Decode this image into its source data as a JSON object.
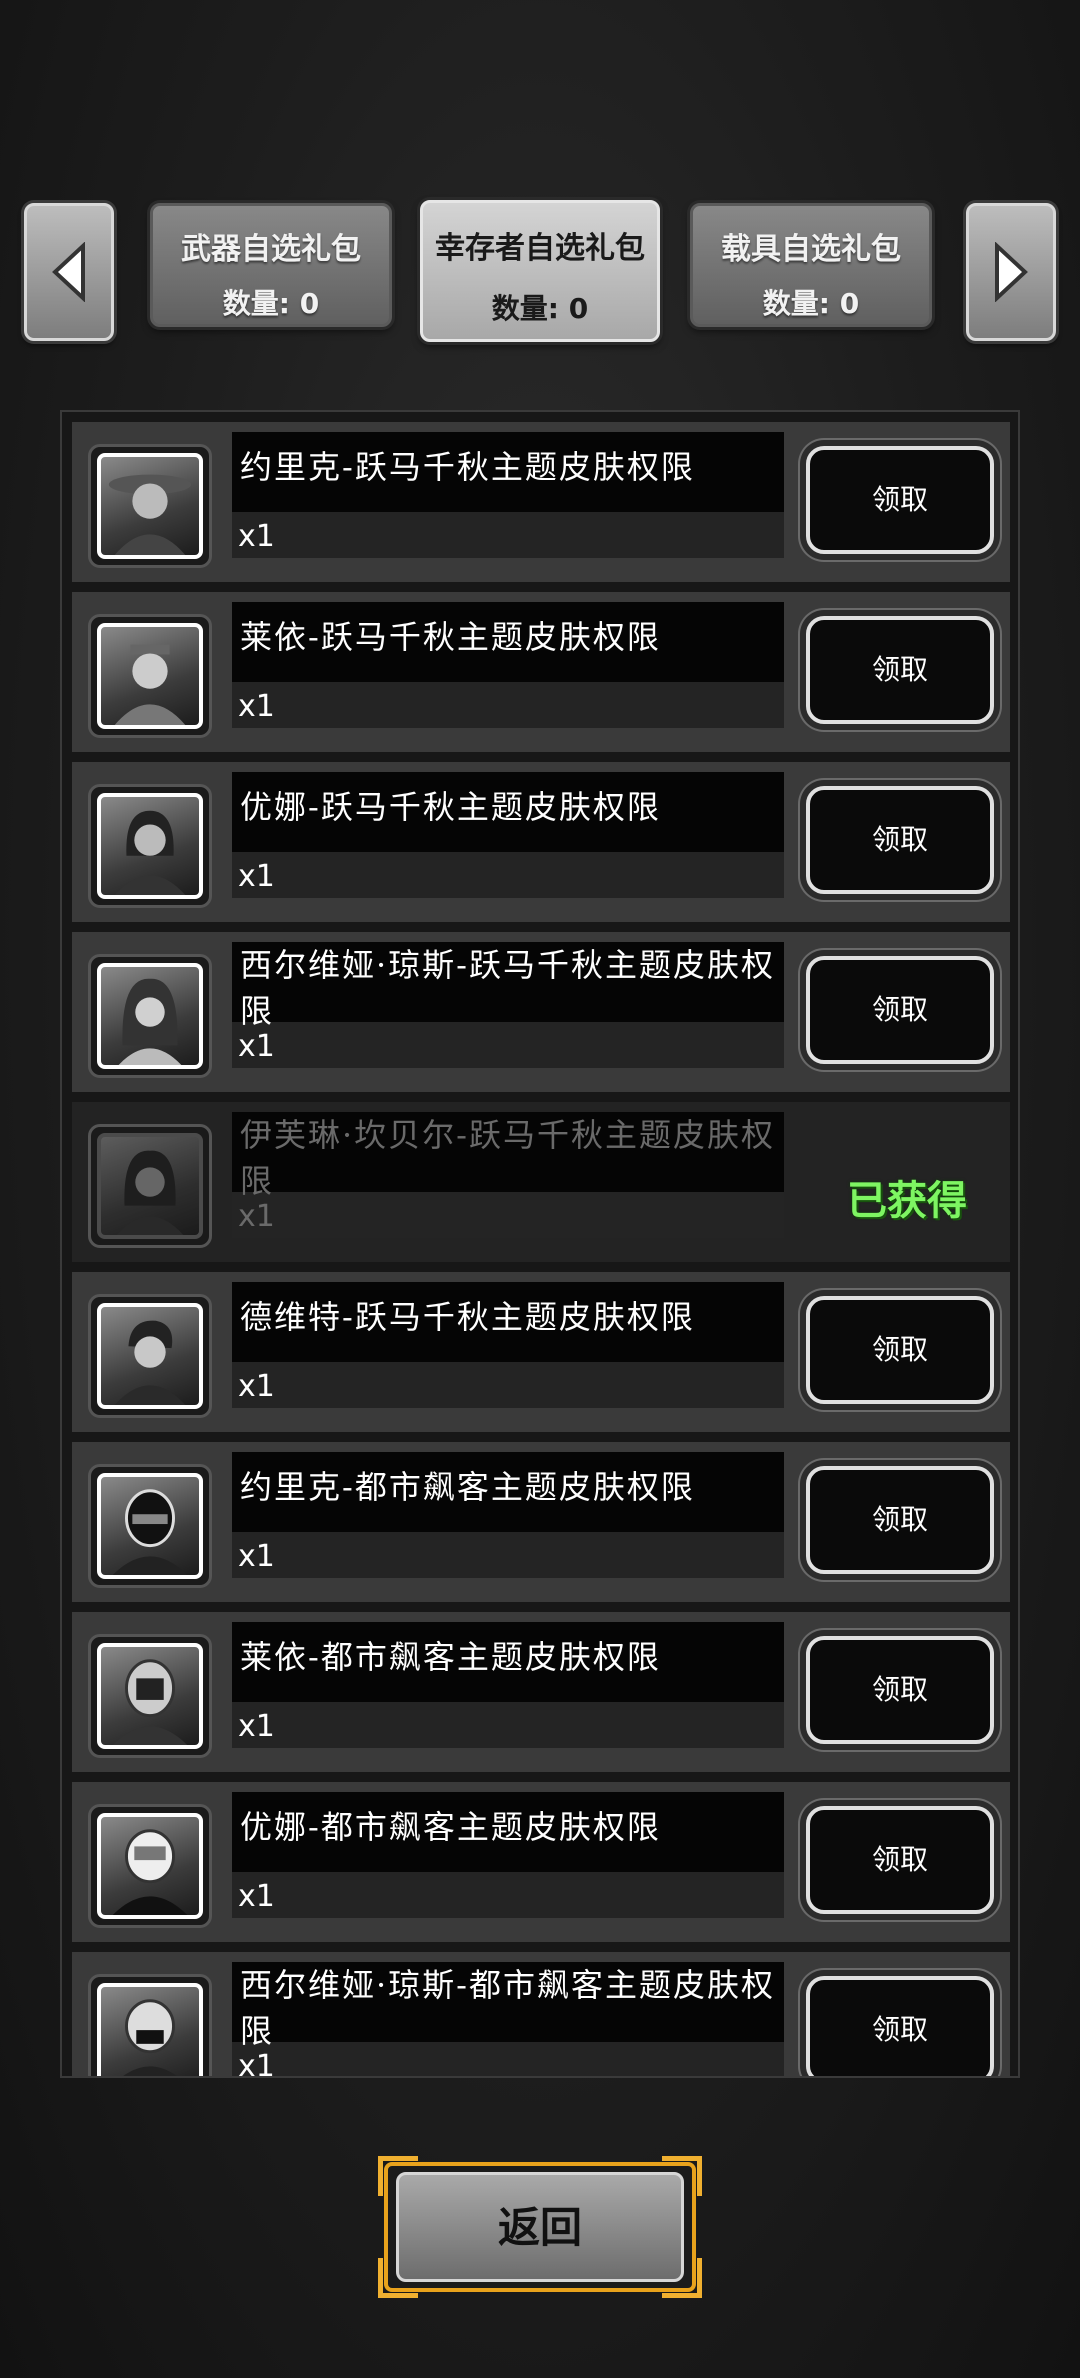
{
  "tabs": [
    {
      "title": "武器自选礼包",
      "count": "数量: 0",
      "active": false
    },
    {
      "title": "幸存者自选礼包",
      "count": "数量: 0",
      "active": true
    },
    {
      "title": "载具自选礼包",
      "count": "数量: 0",
      "active": false
    }
  ],
  "items": [
    {
      "name": "约里克-跃马千秋主题皮肤权限",
      "qty": "x1",
      "button": "领取"
    },
    {
      "name": "莱依-跃马千秋主题皮肤权限",
      "qty": "x1",
      "button": "领取"
    },
    {
      "name": "优娜-跃马千秋主题皮肤权限",
      "qty": "x1",
      "button": "领取"
    },
    {
      "name": "西尔维娅·琼斯-跃马千秋主题皮肤权限",
      "qty": "x1",
      "button": "领取"
    },
    {
      "name": "伊芙琳·坎贝尔-跃马千秋主题皮肤权限",
      "qty": "x1",
      "status": "已获得"
    },
    {
      "name": "德维特-跃马千秋主题皮肤权限",
      "qty": "x1",
      "button": "领取"
    },
    {
      "name": "约里克-都市飙客主题皮肤权限",
      "qty": "x1",
      "button": "领取"
    },
    {
      "name": "莱依-都市飙客主题皮肤权限",
      "qty": "x1",
      "button": "领取"
    },
    {
      "name": "优娜-都市飙客主题皮肤权限",
      "qty": "x1",
      "button": "领取"
    },
    {
      "name": "西尔维娅·琼斯-都市飙客主题皮肤权限",
      "qty": "x1",
      "button": "领取"
    }
  ],
  "back_button": "返回",
  "colors": {
    "claimed_status": "#7ef562",
    "back_frame": "#e8a21c"
  }
}
